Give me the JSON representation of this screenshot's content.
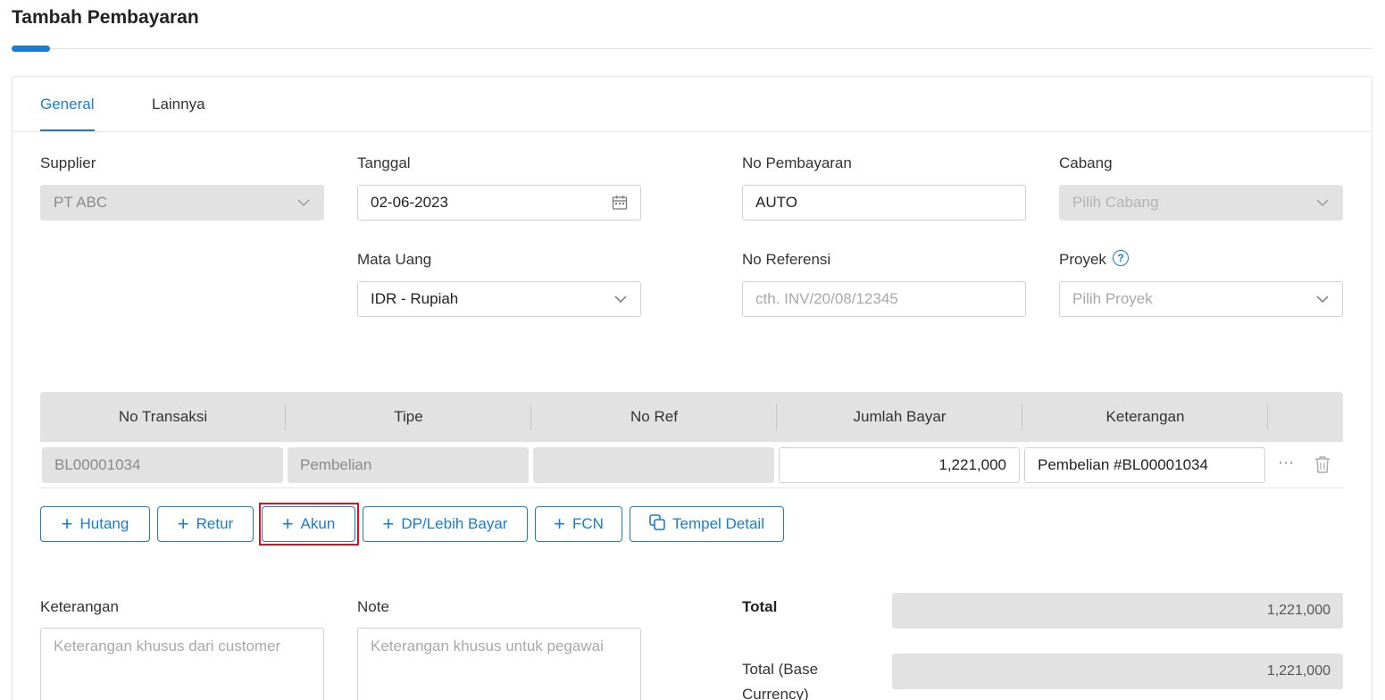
{
  "page": {
    "title": "Tambah Pembayaran"
  },
  "tabs": [
    {
      "label": "General",
      "active": true
    },
    {
      "label": "Lainnya",
      "active": false
    }
  ],
  "form": {
    "supplier": {
      "label": "Supplier",
      "value": "PT ABC",
      "disabled": true,
      "icon": "chevron-down-icon"
    },
    "tanggal": {
      "label": "Tanggal",
      "value": "02-06-2023",
      "icon": "calendar-icon"
    },
    "no_pembayaran": {
      "label": "No Pembayaran",
      "value": "AUTO"
    },
    "cabang": {
      "label": "Cabang",
      "placeholder": "Pilih Cabang",
      "disabled": true,
      "icon": "chevron-down-icon"
    },
    "mata_uang": {
      "label": "Mata Uang",
      "value": "IDR - Rupiah",
      "icon": "chevron-down-icon"
    },
    "no_referensi": {
      "label": "No Referensi",
      "placeholder": "cth. INV/20/08/12345"
    },
    "proyek": {
      "label": "Proyek",
      "placeholder": "Pilih Proyek",
      "help_glyph": "?",
      "icon": "chevron-down-icon"
    }
  },
  "table": {
    "columns": [
      "No Transaksi",
      "Tipe",
      "No Ref",
      "Jumlah Bayar",
      "Keterangan"
    ],
    "rows": [
      {
        "no_transaksi": "BL00001034",
        "tipe": "Pembelian",
        "no_ref": "",
        "jumlah_bayar": "1,221,000",
        "keterangan": "Pembelian #BL00001034"
      }
    ],
    "row_actions": {
      "more_glyph": "⋯",
      "delete_icon": "trash-icon"
    }
  },
  "actions": [
    {
      "label": "Hutang",
      "icon": "plus-icon"
    },
    {
      "label": "Retur",
      "icon": "plus-icon"
    },
    {
      "label": "Akun",
      "icon": "plus-icon",
      "highlighted": true,
      "highlight_color": "#d8141d"
    },
    {
      "label": "DP/Lebih Bayar",
      "icon": "plus-icon"
    },
    {
      "label": "FCN",
      "icon": "plus-icon"
    },
    {
      "label": "Tempel Detail",
      "icon": "copy-icon"
    }
  ],
  "footer": {
    "keterangan": {
      "label": "Keterangan",
      "placeholder": "Keterangan khusus dari customer"
    },
    "note": {
      "label": "Note",
      "placeholder": "Keterangan khusus untuk pegawai"
    },
    "total": {
      "label": "Total",
      "value": "1,221,000"
    },
    "total_base": {
      "label": "Total (Base Currency)",
      "value": "1,221,000"
    }
  },
  "colors": {
    "accent": "#1a7ccf",
    "disabled_bg": "#e2e2e2",
    "highlight": "#d8141d"
  }
}
